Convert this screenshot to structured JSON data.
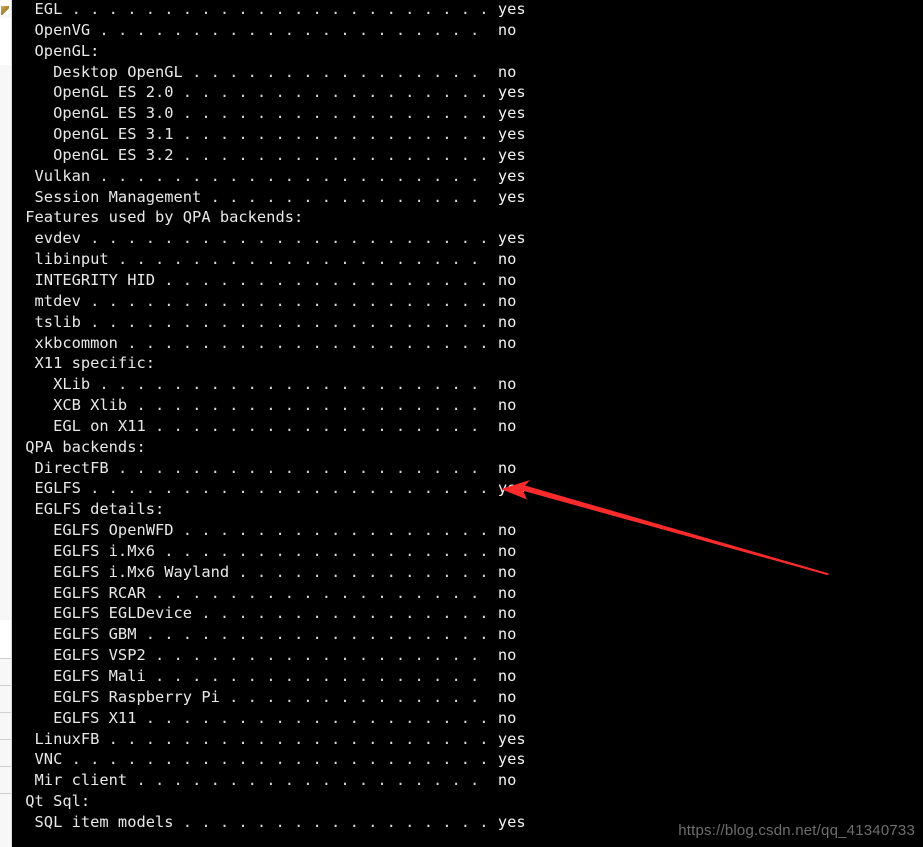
{
  "app": {
    "type": "terminal-output",
    "background_color": "#000000",
    "text_color": "#e8e8e8",
    "leader_char": "."
  },
  "terminal": {
    "lines": [
      {
        "indent": 1,
        "label": "EGL",
        "value": "yes"
      },
      {
        "indent": 1,
        "label": "OpenVG",
        "value": "no"
      },
      {
        "indent": 1,
        "label": "OpenGL:",
        "value": ""
      },
      {
        "indent": 2,
        "label": "Desktop OpenGL",
        "value": "no"
      },
      {
        "indent": 2,
        "label": "OpenGL ES 2.0",
        "value": "yes"
      },
      {
        "indent": 2,
        "label": "OpenGL ES 3.0",
        "value": "yes"
      },
      {
        "indent": 2,
        "label": "OpenGL ES 3.1",
        "value": "yes"
      },
      {
        "indent": 2,
        "label": "OpenGL ES 3.2",
        "value": "yes"
      },
      {
        "indent": 1,
        "label": "Vulkan",
        "value": "yes"
      },
      {
        "indent": 1,
        "label": "Session Management",
        "value": "yes"
      },
      {
        "indent": 0,
        "label": "Features used by QPA backends:",
        "value": ""
      },
      {
        "indent": 1,
        "label": "evdev",
        "value": "yes"
      },
      {
        "indent": 1,
        "label": "libinput",
        "value": "no"
      },
      {
        "indent": 1,
        "label": "INTEGRITY HID",
        "value": "no"
      },
      {
        "indent": 1,
        "label": "mtdev",
        "value": "no"
      },
      {
        "indent": 1,
        "label": "tslib",
        "value": "no"
      },
      {
        "indent": 1,
        "label": "xkbcommon",
        "value": "no"
      },
      {
        "indent": 1,
        "label": "X11 specific:",
        "value": ""
      },
      {
        "indent": 2,
        "label": "XLib",
        "value": "no"
      },
      {
        "indent": 2,
        "label": "XCB Xlib",
        "value": "no"
      },
      {
        "indent": 2,
        "label": "EGL on X11",
        "value": "no"
      },
      {
        "indent": 0,
        "label": "QPA backends:",
        "value": ""
      },
      {
        "indent": 1,
        "label": "DirectFB",
        "value": "no"
      },
      {
        "indent": 1,
        "label": "EGLFS",
        "value": "yes"
      },
      {
        "indent": 1,
        "label": "EGLFS details:",
        "value": ""
      },
      {
        "indent": 2,
        "label": "EGLFS OpenWFD",
        "value": "no"
      },
      {
        "indent": 2,
        "label": "EGLFS i.Mx6",
        "value": "no"
      },
      {
        "indent": 2,
        "label": "EGLFS i.Mx6 Wayland",
        "value": "no"
      },
      {
        "indent": 2,
        "label": "EGLFS RCAR",
        "value": "no"
      },
      {
        "indent": 2,
        "label": "EGLFS EGLDevice",
        "value": "no"
      },
      {
        "indent": 2,
        "label": "EGLFS GBM",
        "value": "no"
      },
      {
        "indent": 2,
        "label": "EGLFS VSP2",
        "value": "no"
      },
      {
        "indent": 2,
        "label": "EGLFS Mali",
        "value": "no"
      },
      {
        "indent": 2,
        "label": "EGLFS Raspberry Pi",
        "value": "no"
      },
      {
        "indent": 2,
        "label": "EGLFS X11",
        "value": "no"
      },
      {
        "indent": 1,
        "label": "LinuxFB",
        "value": "yes"
      },
      {
        "indent": 1,
        "label": "VNC",
        "value": "yes"
      },
      {
        "indent": 1,
        "label": "Mir client",
        "value": "no"
      },
      {
        "indent": 0,
        "label": "Qt Sql:",
        "value": ""
      },
      {
        "indent": 1,
        "label": "SQL item models",
        "value": "yes"
      }
    ]
  },
  "annotation": {
    "arrow_color": "#fb2b2b",
    "points_at_line_label": "EGLFS",
    "points_at_line_value": "yes"
  },
  "watermark": {
    "text": "https://blog.csdn.net/qq_41340733",
    "color": "#6e6e6e"
  }
}
